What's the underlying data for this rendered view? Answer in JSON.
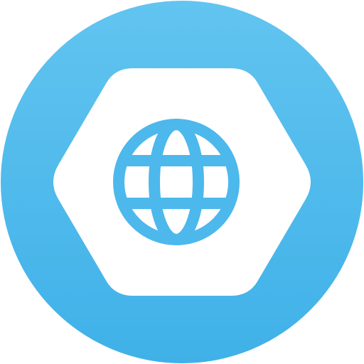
{
  "icon": {
    "name": "browser-globe-app-icon",
    "badge_shape": "circle",
    "inner_shape": "rounded-hexagon",
    "glyph": "globe-icon"
  },
  "colors": {
    "badge_top": "#62C4F0",
    "badge_bottom": "#3FB1E8",
    "hexagon_fill": "#FFFFFF",
    "globe_stroke": "#4DB8EC",
    "page_background": "#FFFFFF"
  }
}
